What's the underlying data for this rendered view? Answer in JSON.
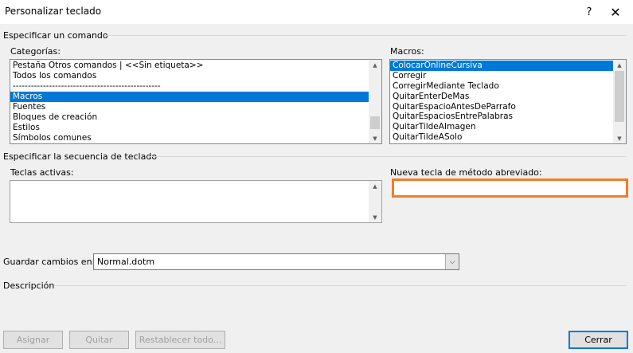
{
  "window": {
    "title": "Personalizar teclado",
    "help_glyph": "?",
    "close_glyph": "✕"
  },
  "specify_command": {
    "section_label": "Especificar un comando",
    "categories": {
      "label": "Categorías:",
      "items": [
        "Pestaña Otros comandos | <<Sin etiqueta>>",
        "Todos los comandos",
        "-------------------------------------------------",
        "Macros",
        "Fuentes",
        "Bloques de creación",
        "Estilos",
        "Símbolos comunes"
      ],
      "selected_index": 3
    },
    "macros": {
      "label": "Macros:",
      "items": [
        "ColocarOnlineCursiva",
        "Corregir",
        "CorregirMediante Teclado",
        "QuitarEnterDeMas",
        "QuitarEspacioAntesDeParrafo",
        "QuitarEspaciosEntrePalabras",
        "QuitarTildeAImagen",
        "QuitarTildeASolo"
      ],
      "selected_index": 0
    }
  },
  "keyboard_sequence": {
    "section_label": "Especificar la secuencia de teclado",
    "current_keys_label": "Teclas activas:",
    "new_shortcut_label": "Nueva tecla de método abreviado:",
    "new_shortcut_value": ""
  },
  "save_changes": {
    "label": "Guardar cambios en:",
    "value": "Normal.dotm"
  },
  "description": {
    "label": "Descripción"
  },
  "buttons": {
    "assign": "Asignar",
    "remove": "Quitar",
    "reset_all": "Restablecer todo...",
    "close": "Cerrar"
  },
  "colors": {
    "selection": "#0078d7",
    "highlight": "#f47b2a",
    "dialog_bg": "#f0f0f0"
  },
  "icons": [
    "help-icon",
    "close-icon",
    "scroll-up-icon",
    "scroll-down-icon",
    "dropdown-chevron-icon"
  ]
}
